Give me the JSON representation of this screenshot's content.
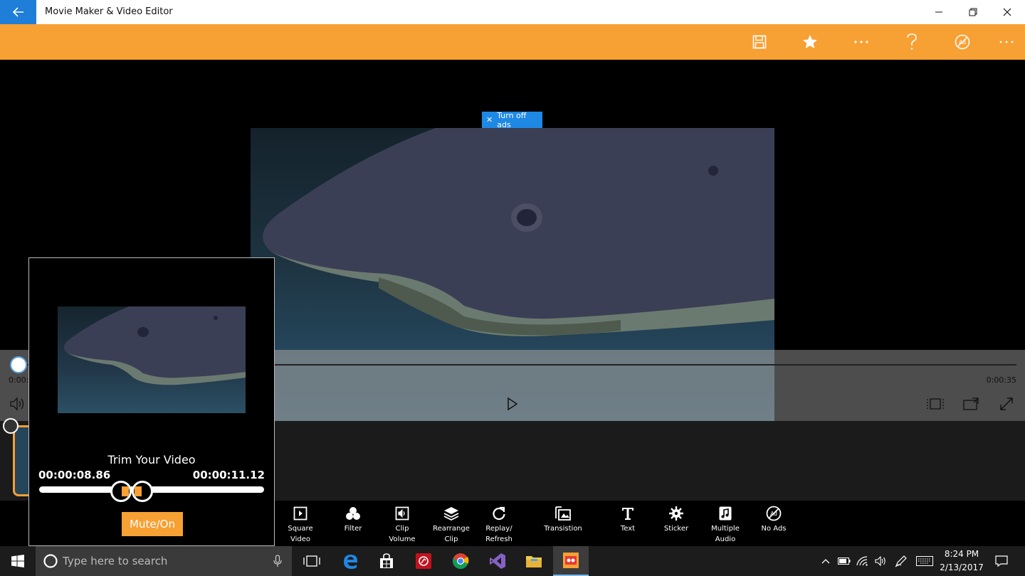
{
  "window": {
    "title": "Movie Maker & Video Editor"
  },
  "ad": {
    "close_label": "✕",
    "text": "Turn off ads"
  },
  "player": {
    "time_start": "0:00:",
    "time_end": "0:00:35",
    "progress_fraction": 0.0
  },
  "trim": {
    "title": "Trim Your Video",
    "start_time": "00:00:08.86",
    "end_time": "00:00:11.12",
    "mute_label": "Mute/On"
  },
  "tools": [
    {
      "label1": "Square",
      "label2": "Video",
      "icon": "square-video-icon"
    },
    {
      "label1": "Filter",
      "label2": "",
      "icon": "filter-icon"
    },
    {
      "label1": "Clip",
      "label2": "Volume",
      "icon": "clip-volume-icon"
    },
    {
      "label1": "Rearrange",
      "label2": "Clip",
      "icon": "rearrange-icon"
    },
    {
      "label1": "Replay/",
      "label2": "Refresh",
      "icon": "replay-icon"
    },
    {
      "label1": "Transistion",
      "label2": "",
      "icon": "transition-icon"
    },
    {
      "label1": "Text",
      "label2": "",
      "icon": "text-icon"
    },
    {
      "label1": "Sticker",
      "label2": "",
      "icon": "sticker-icon"
    },
    {
      "label1": "Multiple",
      "label2": "Audio",
      "icon": "audio-icon"
    },
    {
      "label1": "No Ads",
      "label2": "",
      "icon": "no-ads-icon"
    }
  ],
  "taskbar": {
    "search_placeholder": "Type here to search",
    "time": "8:24 PM",
    "date": "2/13/2017"
  },
  "colors": {
    "accent_orange": "#f7a033",
    "title_blue": "#1e7ed8"
  }
}
